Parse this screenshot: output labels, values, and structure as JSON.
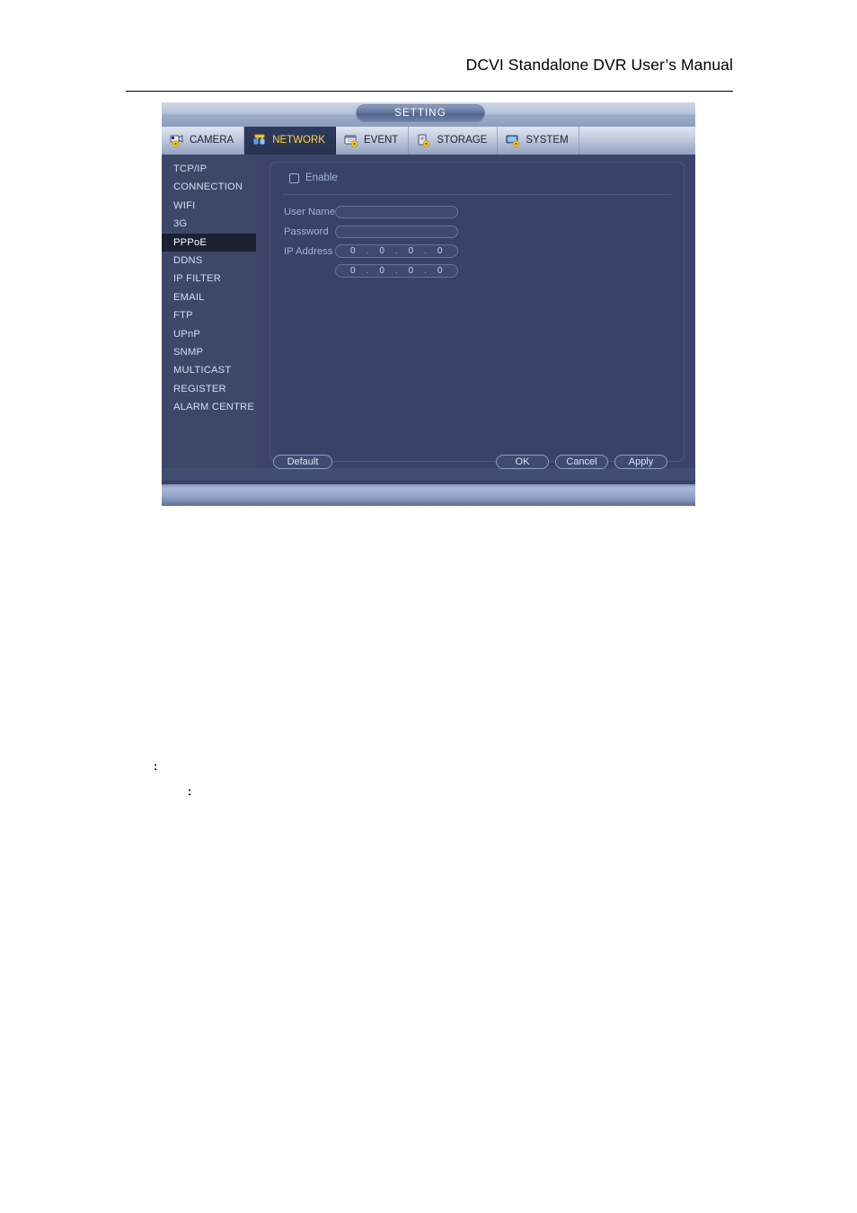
{
  "document": {
    "header_title": "DCVI Standalone DVR User’s Manual",
    "body_marks": [
      ":",
      ":"
    ]
  },
  "dialog": {
    "window_title": "SETTING",
    "tabs": [
      {
        "label": "CAMERA",
        "icon": "camera-gear-icon",
        "active": false
      },
      {
        "label": "NETWORK",
        "icon": "network-gear-icon",
        "active": true
      },
      {
        "label": "EVENT",
        "icon": "event-gear-icon",
        "active": false
      },
      {
        "label": "STORAGE",
        "icon": "storage-gear-icon",
        "active": false
      },
      {
        "label": "SYSTEM",
        "icon": "system-gear-icon",
        "active": false
      }
    ],
    "sidebar": {
      "selected": "PPPoE",
      "items": [
        {
          "label": "TCP/IP"
        },
        {
          "label": "CONNECTION"
        },
        {
          "label": "WIFI"
        },
        {
          "label": "3G"
        },
        {
          "label": "PPPoE"
        },
        {
          "label": "DDNS"
        },
        {
          "label": "IP FILTER"
        },
        {
          "label": "EMAIL"
        },
        {
          "label": "FTP"
        },
        {
          "label": "UPnP"
        },
        {
          "label": "SNMP"
        },
        {
          "label": "MULTICAST"
        },
        {
          "label": "REGISTER"
        },
        {
          "label": "ALARM CENTRE"
        }
      ]
    },
    "form": {
      "enable": {
        "label": "Enable",
        "checked": false
      },
      "user_name": {
        "label": "User Name",
        "value": "",
        "placeholder": ""
      },
      "password": {
        "label": "Password",
        "value": "",
        "placeholder": ""
      },
      "ip_address": {
        "label": "IP Address",
        "primary": {
          "o1": "0",
          "o2": "0",
          "o3": "0",
          "o4": "0"
        },
        "secondary": {
          "o1": "0",
          "o2": "0",
          "o3": "0",
          "o4": "0"
        },
        "separator": "."
      }
    },
    "buttons": {
      "default": "Default",
      "ok": "OK",
      "cancel": "Cancel",
      "apply": "Apply"
    },
    "colors": {
      "panel_bg": "#39436a",
      "body_bg": "#3b4468",
      "sidebar_bg": "#3d4869",
      "selected_item_bg": "#1b2133",
      "active_tab_bg": "#2e3a5e",
      "active_tab_text": "#ffd64a",
      "label_text": "#9fb2dc",
      "accent_gear": "#ffcc33"
    }
  }
}
